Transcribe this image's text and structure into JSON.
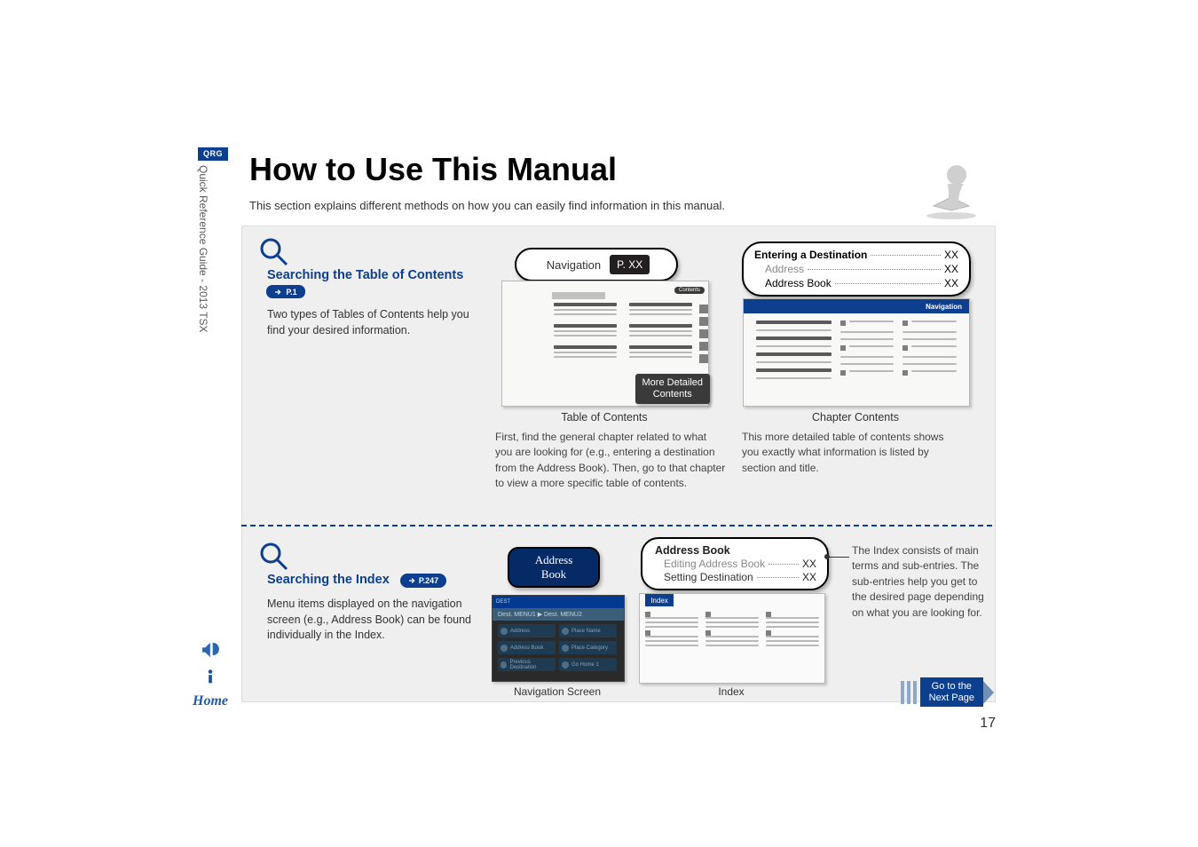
{
  "sidebar": {
    "qrg": "QRG",
    "title": "Quick Reference Guide - 2013 TSX",
    "home": "Home"
  },
  "header": {
    "title": "How to Use This Manual",
    "subtitle": "This section explains different methods on how you can easily find information in this manual."
  },
  "section1": {
    "title": "Searching the Table of Contents",
    "page_ref": "P.1",
    "desc": "Two types of Tables of Contents help you find your desired information."
  },
  "nav_bubble": {
    "label": "Navigation",
    "page": "P. XX"
  },
  "toc_thumb": {
    "contents_pill": "Contents",
    "detailed_label_line1": "More Detailed",
    "detailed_label_line2": "Contents",
    "caption": "Table of Contents",
    "para": "First, find the general chapter related to what you are looking for (e.g., entering a destination from the Address Book). Then, go to that chapter to view a more specific table of contents."
  },
  "entering_bubble": {
    "title": "Entering a Destination",
    "title_page": "XX",
    "sub1_label": "Address",
    "sub1_page": "XX",
    "sub2_label": "Address Book",
    "sub2_page": "XX"
  },
  "chap_thumb": {
    "nav_label": "Navigation",
    "caption": "Chapter Contents",
    "para": "This more detailed table of contents shows you exactly what information is listed by section and title."
  },
  "section2": {
    "title": "Searching the Index",
    "page_ref": "P.247",
    "desc": "Menu items displayed on the navigation screen (e.g., Address Book) can be found individually in the Index."
  },
  "address_badge": {
    "line1": "Address",
    "line2": "Book"
  },
  "nav_screen": {
    "dest_label": "DEST",
    "menu_label": "Dest. MENU1  ▶  Dest. MENU2",
    "btn_address": "Address",
    "btn_place_name": "Place Name",
    "btn_address_book": "Address Book",
    "btn_place_category": "Place Category",
    "btn_prev_dest": "Previous Destination",
    "btn_go_home": "Go Home 1",
    "caption": "Navigation Screen"
  },
  "address_list": {
    "heading": "Address Book",
    "row1_label": "Editing Address Book",
    "row1_page": "XX",
    "row2_label": "Setting Destination",
    "row2_page": "XX"
  },
  "index_thumb": {
    "envelope": "Index",
    "caption": "Index"
  },
  "index_para": "The Index consists of main terms and sub-entries. The sub-entries help you get to the desired page depending on what you are looking for.",
  "next": {
    "line1": "Go to the",
    "line2": "Next Page"
  },
  "page_number": "17"
}
